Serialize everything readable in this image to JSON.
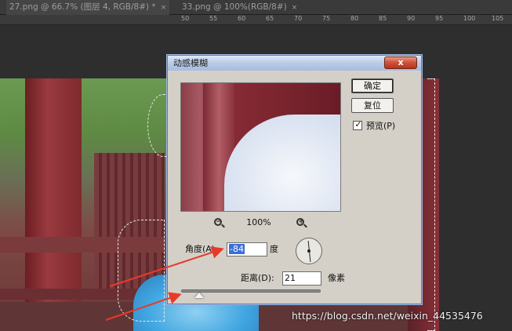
{
  "tabs": [
    {
      "label": "27.png @ 66.7% (图层 4, RGB/8#) *",
      "close": "×"
    },
    {
      "label": "33.png @ 100%(RGB/8#)",
      "close": "×"
    }
  ],
  "ruler": {
    "labels": [
      "50",
      "55",
      "60",
      "65",
      "70",
      "75",
      "80",
      "85",
      "90",
      "95",
      "100",
      "105"
    ]
  },
  "dialog": {
    "title": "动感模糊",
    "close_glyph": "x",
    "ok_label": "确定",
    "reset_label": "复位",
    "preview_label": "预览(P)",
    "preview_checked": true,
    "check_glyph": "✓",
    "zoom_out_glyph": "−",
    "zoom_in_glyph": "+",
    "zoom_percent": "100%",
    "angle_label": "角度(A):",
    "angle_value": "-84",
    "angle_unit": "度",
    "distance_label": "距离(D):",
    "distance_value": "21",
    "distance_unit": "像素"
  },
  "colors": {
    "annotation_arrow": "#e83a2a",
    "title_gradient_top": "#dfe8f6",
    "selection_highlight": "#3a6fd6"
  },
  "watermark": "https://blog.csdn.net/weixin_44535476"
}
